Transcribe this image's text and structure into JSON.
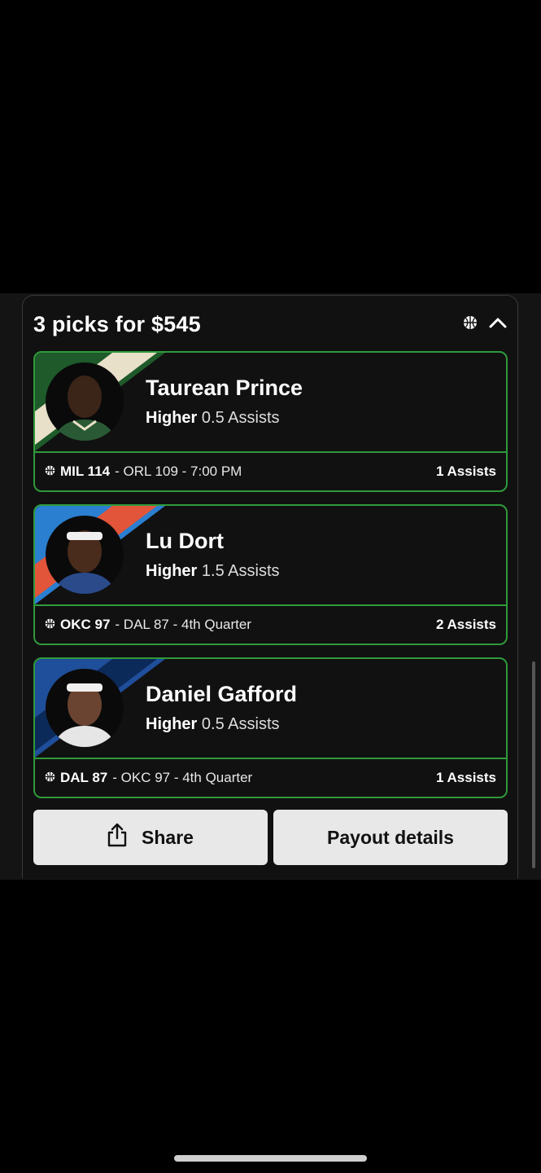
{
  "header": {
    "title": "3 picks for $545",
    "sport_icon": "basketball-icon",
    "collapse_icon": "chevron-up-icon"
  },
  "picks": [
    {
      "name": "Taurean Prince",
      "direction": "Higher",
      "line": "0.5 Assists",
      "team": "MIL 114",
      "matchup": "- ORL 109 - 7:00 PM",
      "result": "1 Assists",
      "stripe_colors": [
        "#1e5a2a",
        "#e8e0c8"
      ]
    },
    {
      "name": "Lu Dort",
      "direction": "Higher",
      "line": "1.5 Assists",
      "team": "OKC 97",
      "matchup": "- DAL 87 - 4th Quarter",
      "result": "2 Assists",
      "stripe_colors": [
        "#2a7fd0",
        "#e2553a"
      ]
    },
    {
      "name": "Daniel Gafford",
      "direction": "Higher",
      "line": "0.5 Assists",
      "team": "DAL 87",
      "matchup": "- OKC 97 - 4th Quarter",
      "result": "1 Assists",
      "stripe_colors": [
        "#1f4e9a",
        "#0b2a5a"
      ]
    }
  ],
  "buttons": {
    "share_label": "Share",
    "payout_label": "Payout details"
  },
  "colors": {
    "accent_green": "#2f9a3a",
    "button_bg": "#e8e8e8"
  }
}
